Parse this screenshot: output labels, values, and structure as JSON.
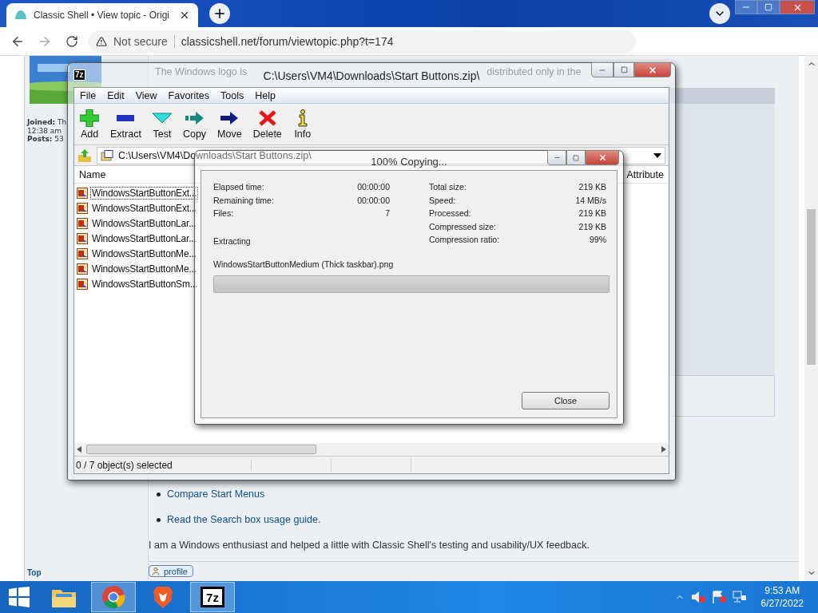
{
  "browser": {
    "tab": {
      "title": "Classic Shell • View topic - Origi",
      "selected": true
    },
    "address": {
      "security": "Not secure",
      "url": "classicshell.net/forum/viewtopic.php?t=174"
    }
  },
  "page": {
    "post_text_before": "The Windows logo is",
    "post_text_after": "distributed only in the",
    "author_lines": [
      "**Joined:** Th",
      "12:38 am",
      "**Posts:** 53"
    ],
    "links": [
      "Compare Start Menus",
      "Read the Search box usage guide."
    ],
    "bio": "I am a Windows enthusiast and helped a little with Classic Shell's testing and usability/UX feedback.",
    "top_link": "Top",
    "profile_button": "profile"
  },
  "archive_window": {
    "icon_text": "7z",
    "title": "C:\\Users\\VM4\\Downloads\\Start Buttons.zip\\",
    "menu": [
      "File",
      "Edit",
      "View",
      "Favorites",
      "Tools",
      "Help"
    ],
    "toolbar": [
      {
        "label": "Add",
        "kind": "add"
      },
      {
        "label": "Extract",
        "kind": "extract"
      },
      {
        "label": "Test",
        "kind": "test"
      },
      {
        "label": "Copy",
        "kind": "copy"
      },
      {
        "label": "Move",
        "kind": "move"
      },
      {
        "label": "Delete",
        "kind": "delete"
      },
      {
        "label": "Info",
        "kind": "info"
      }
    ],
    "path": "C:\\Users\\VM4\\Downloads\\Start Buttons.zip\\",
    "columns": [
      "Name",
      "Attribute"
    ],
    "files": [
      {
        "name": "WindowsStartButtonExt...",
        "focused": true
      },
      {
        "name": "WindowsStartButtonExt...",
        "focused": false
      },
      {
        "name": "WindowsStartButtonLar...",
        "focused": false
      },
      {
        "name": "WindowsStartButtonLar...",
        "focused": false
      },
      {
        "name": "WindowsStartButtonMe...",
        "focused": false
      },
      {
        "name": "WindowsStartButtonMe...",
        "focused": false
      },
      {
        "name": "WindowsStartButtonSm...",
        "focused": false
      }
    ],
    "status": "0 / 7 object(s) selected"
  },
  "progress_dialog": {
    "title": "100% Copying...",
    "stats_left": [
      {
        "label": "Elapsed time:",
        "value": "00:00:00"
      },
      {
        "label": "Remaining time:",
        "value": "00:00:00"
      },
      {
        "label": "Files:",
        "value": "7"
      }
    ],
    "stats_right": [
      {
        "label": "Total size:",
        "value": "219 KB"
      },
      {
        "label": "Speed:",
        "value": "14 MB/s"
      },
      {
        "label": "Processed:",
        "value": "219 KB"
      },
      {
        "label": "Compressed size:",
        "value": "219 KB"
      },
      {
        "label": "Compression ratio:",
        "value": "99%"
      }
    ],
    "action": "Extracting",
    "current_file": "WindowsStartButtonMedium (Thick taskbar).png",
    "level": 1,
    "close_button": "Close"
  },
  "taskbar": {
    "apps": [
      {
        "kind": "explorer",
        "active": false
      },
      {
        "kind": "chrome",
        "active": true
      },
      {
        "kind": "brave",
        "active": false
      },
      {
        "kind": "sevenzip",
        "active": true,
        "icon_text": "7z"
      }
    ],
    "time": "9:53 AM",
    "date": "6/27/2022"
  }
}
